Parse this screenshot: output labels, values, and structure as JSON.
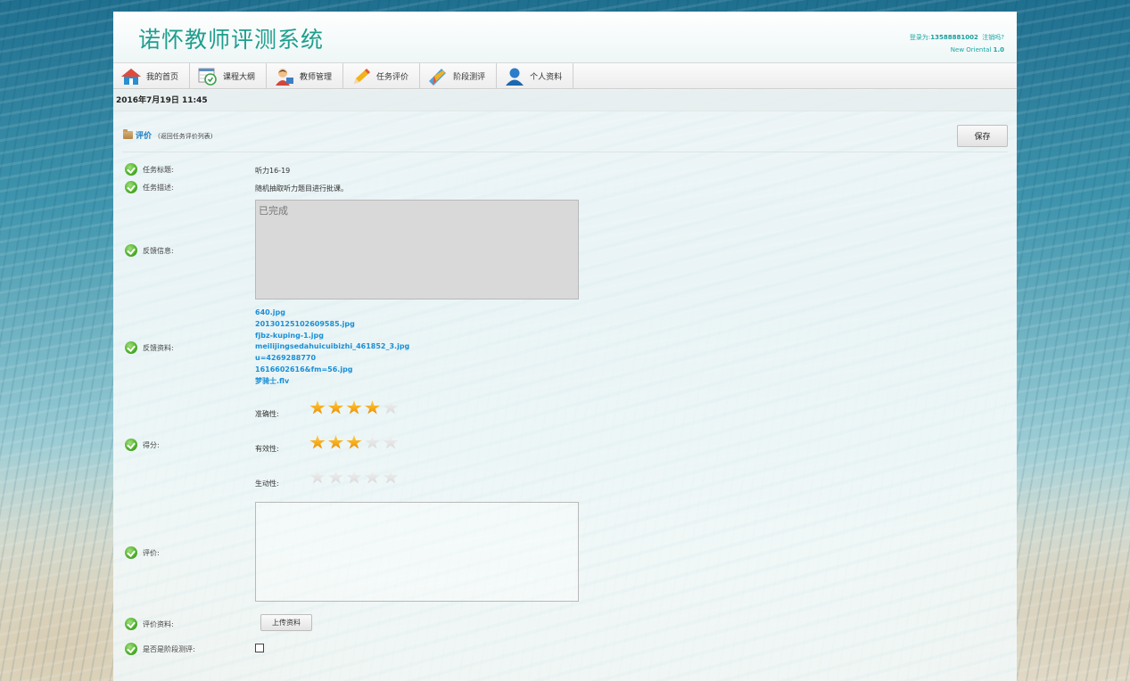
{
  "app": {
    "title": "诺怀教师评测系统",
    "login_prefix": "登录为:",
    "login_user": "13588881002",
    "logout_label": "注销吗?",
    "brand": "New Oriental",
    "version": "1.0"
  },
  "nav": {
    "items": [
      {
        "label": "我的首页",
        "icon": "home-icon"
      },
      {
        "label": "课程大纲",
        "icon": "calendar-icon"
      },
      {
        "label": "教师管理",
        "icon": "teacher-icon"
      },
      {
        "label": "任务评价",
        "icon": "pencil-icon"
      },
      {
        "label": "阶段测评",
        "icon": "ruler-icon"
      },
      {
        "label": "个人资料",
        "icon": "user-icon"
      }
    ]
  },
  "date": "2016年7月19日 11:45",
  "section": {
    "title": "评价",
    "subtitle": "(返回任务评价列表)",
    "save_label": "保存"
  },
  "form": {
    "task_title_label": "任务标题:",
    "task_title_value": "听力16-19",
    "task_desc_label": "任务描述:",
    "task_desc_value": "随机抽取听力题目进行批课。",
    "feedback_info_label": "反馈信息:",
    "feedback_info_value": "已完成",
    "feedback_files_label": "反馈资料:",
    "feedback_files": [
      "640.jpg",
      "20130125102609585.jpg",
      "fjbz-kuping-1.jpg",
      "meilijingsedahuicuibizhi_461852_3.jpg",
      "u=4269288770",
      "1616602616&fm=56.jpg",
      "梦骑士.flv"
    ],
    "score_label": "得分:",
    "ratings": [
      {
        "label": "准确性:",
        "value": 4,
        "max": 5
      },
      {
        "label": "有效性:",
        "value": 3,
        "max": 5
      },
      {
        "label": "生动性:",
        "value": 0,
        "max": 5
      }
    ],
    "comment_label": "评价:",
    "comment_value": "",
    "comment_files_label": "评价资料:",
    "upload_label": "上传资料",
    "is_stage_label": "是否是阶段测评:",
    "is_stage_checked": false
  }
}
